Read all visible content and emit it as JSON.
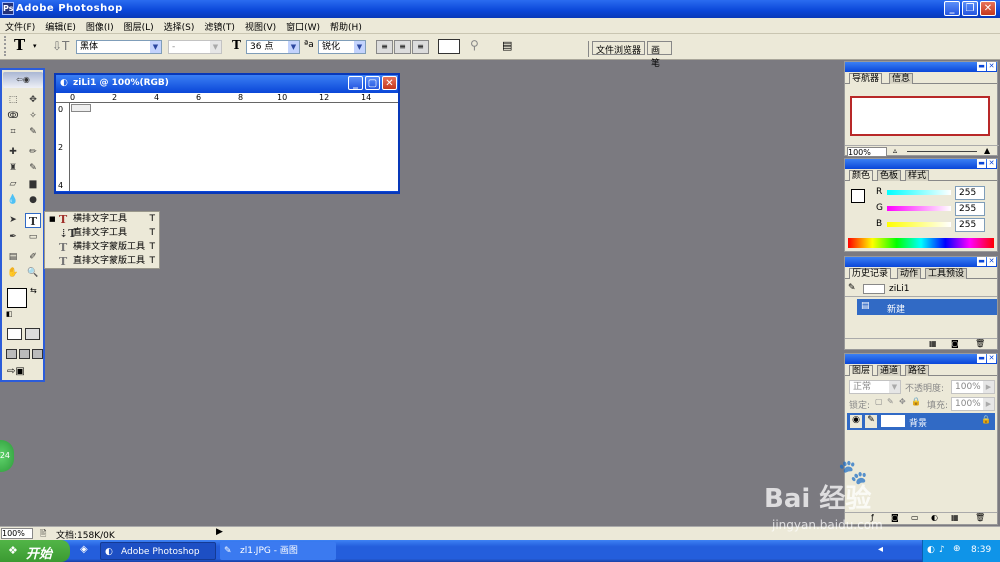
{
  "app": {
    "title": "Adobe Photoshop",
    "icon_name": "photoshop-icon"
  },
  "menu": [
    "文件(F)",
    "编辑(E)",
    "图像(I)",
    "图层(L)",
    "选择(S)",
    "滤镜(T)",
    "视图(V)",
    "窗口(W)",
    "帮助(H)"
  ],
  "options": {
    "font_family": "黑体",
    "font_style": "-",
    "font_size": "36 点",
    "antialias": "锐化",
    "tab_file_browser": "文件浏览器",
    "tab_brushes": "画笔"
  },
  "document": {
    "title": "ziLi1 @ 100%(RGB)",
    "ruler_h": [
      "0",
      "2",
      "4",
      "6",
      "8",
      "10",
      "12",
      "14"
    ],
    "ruler_v": [
      "0",
      "2",
      "4"
    ]
  },
  "tool_flyout": [
    {
      "label": "横排文字工具",
      "key": "T",
      "icon": "horizontal-type-icon",
      "selected": true
    },
    {
      "label": "直排文字工具",
      "key": "T",
      "icon": "vertical-type-icon",
      "selected": false
    },
    {
      "label": "横排文字蒙版工具",
      "key": "T",
      "icon": "horizontal-type-mask-icon",
      "selected": false
    },
    {
      "label": "直排文字蒙版工具",
      "key": "T",
      "icon": "vertical-type-mask-icon",
      "selected": false
    }
  ],
  "navigator": {
    "tabs": [
      "导航器",
      "信息"
    ],
    "zoom": "100%"
  },
  "color": {
    "tabs": [
      "颜色",
      "色板",
      "样式"
    ],
    "channels": [
      {
        "label": "R",
        "value": "255"
      },
      {
        "label": "G",
        "value": "255"
      },
      {
        "label": "B",
        "value": "255"
      }
    ]
  },
  "history": {
    "tabs": [
      "历史记录",
      "动作",
      "工具预设"
    ],
    "snapshot": "ziLi1",
    "step": "新建"
  },
  "layers": {
    "tabs": [
      "图层",
      "通道",
      "路径"
    ],
    "blend_mode": "正常",
    "opacity_label": "不透明度:",
    "opacity_value": "100%",
    "lock_label": "锁定:",
    "fill_label": "填充:",
    "fill_value": "100%",
    "layer_name": "背景"
  },
  "status": {
    "zoom": "100%",
    "doc": "文档:158K/0K"
  },
  "taskbar": {
    "start": "开始",
    "tasks": [
      "Adobe Photoshop",
      "zl1.JPG - 画图"
    ],
    "clock": "8:39"
  },
  "watermark": {
    "brand": "Bai 经验",
    "url": "jingyan.baidu.com"
  },
  "side_badge": "24",
  "colors": {
    "xp_blue": "#0a46d8",
    "workspace": "#7b7a80",
    "panel": "#ece9d8",
    "selection": "#316ac5"
  }
}
